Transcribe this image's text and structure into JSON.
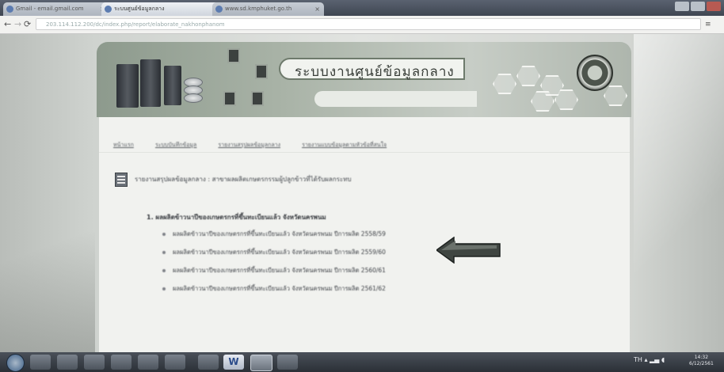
{
  "browser": {
    "tabs": [
      {
        "label": "Gmail - email.gmail.com"
      },
      {
        "label": "ระบบศูนย์ข้อมูลกลาง"
      },
      {
        "label": "www.sd.kmphuket.go.th"
      }
    ],
    "address": "203.114.112.200/dc/index.php/report/elaborate_nakhonphanom"
  },
  "header": {
    "title": "ระบบงานศูนย์ข้อมูลกลาง"
  },
  "nav": {
    "links": [
      "หน้าแรก",
      "ระบบบันทึกข้อมูล",
      "รายงานสรุปผลข้อมูลกลาง",
      "รายงานแบบข้อมูลตามหัวข้อที่สนใจ"
    ]
  },
  "page": {
    "heading": "รายงานสรุปผลข้อมูลกลาง : สาขาผลผลิตเกษตรกรรมผู้ปลูกข้าวที่ได้รับผลกระทบ",
    "section_title": "1. ผลผลิตข้าวนาปีของเกษตรกรที่ขึ้นทะเบียนแล้ว จังหวัดนครพนม",
    "items": [
      "ผลผลิตข้าวนาปีของเกษตรกรที่ขึ้นทะเบียนแล้ว จังหวัดนครพนม ปีการผลิต 2558/59",
      "ผลผลิตข้าวนาปีของเกษตรกรที่ขึ้นทะเบียนแล้ว จังหวัดนครพนม ปีการผลิต 2559/60",
      "ผลผลิตข้าวนาปีของเกษตรกรที่ขึ้นทะเบียนแล้ว จังหวัดนครพนม ปีการผลิต 2560/61",
      "ผลผลิตข้าวนาปีของเกษตรกรที่ขึ้นทะเบียนแล้ว จังหวัดนครพนม ปีการผลิต 2561/62"
    ]
  },
  "taskbar": {
    "word_label": "W",
    "tray_lang": "TH",
    "clock_time": "14:32",
    "clock_date": "6/12/2561"
  },
  "colors": {
    "arrow": "#3f4541",
    "banner": "#a9b3a7"
  }
}
